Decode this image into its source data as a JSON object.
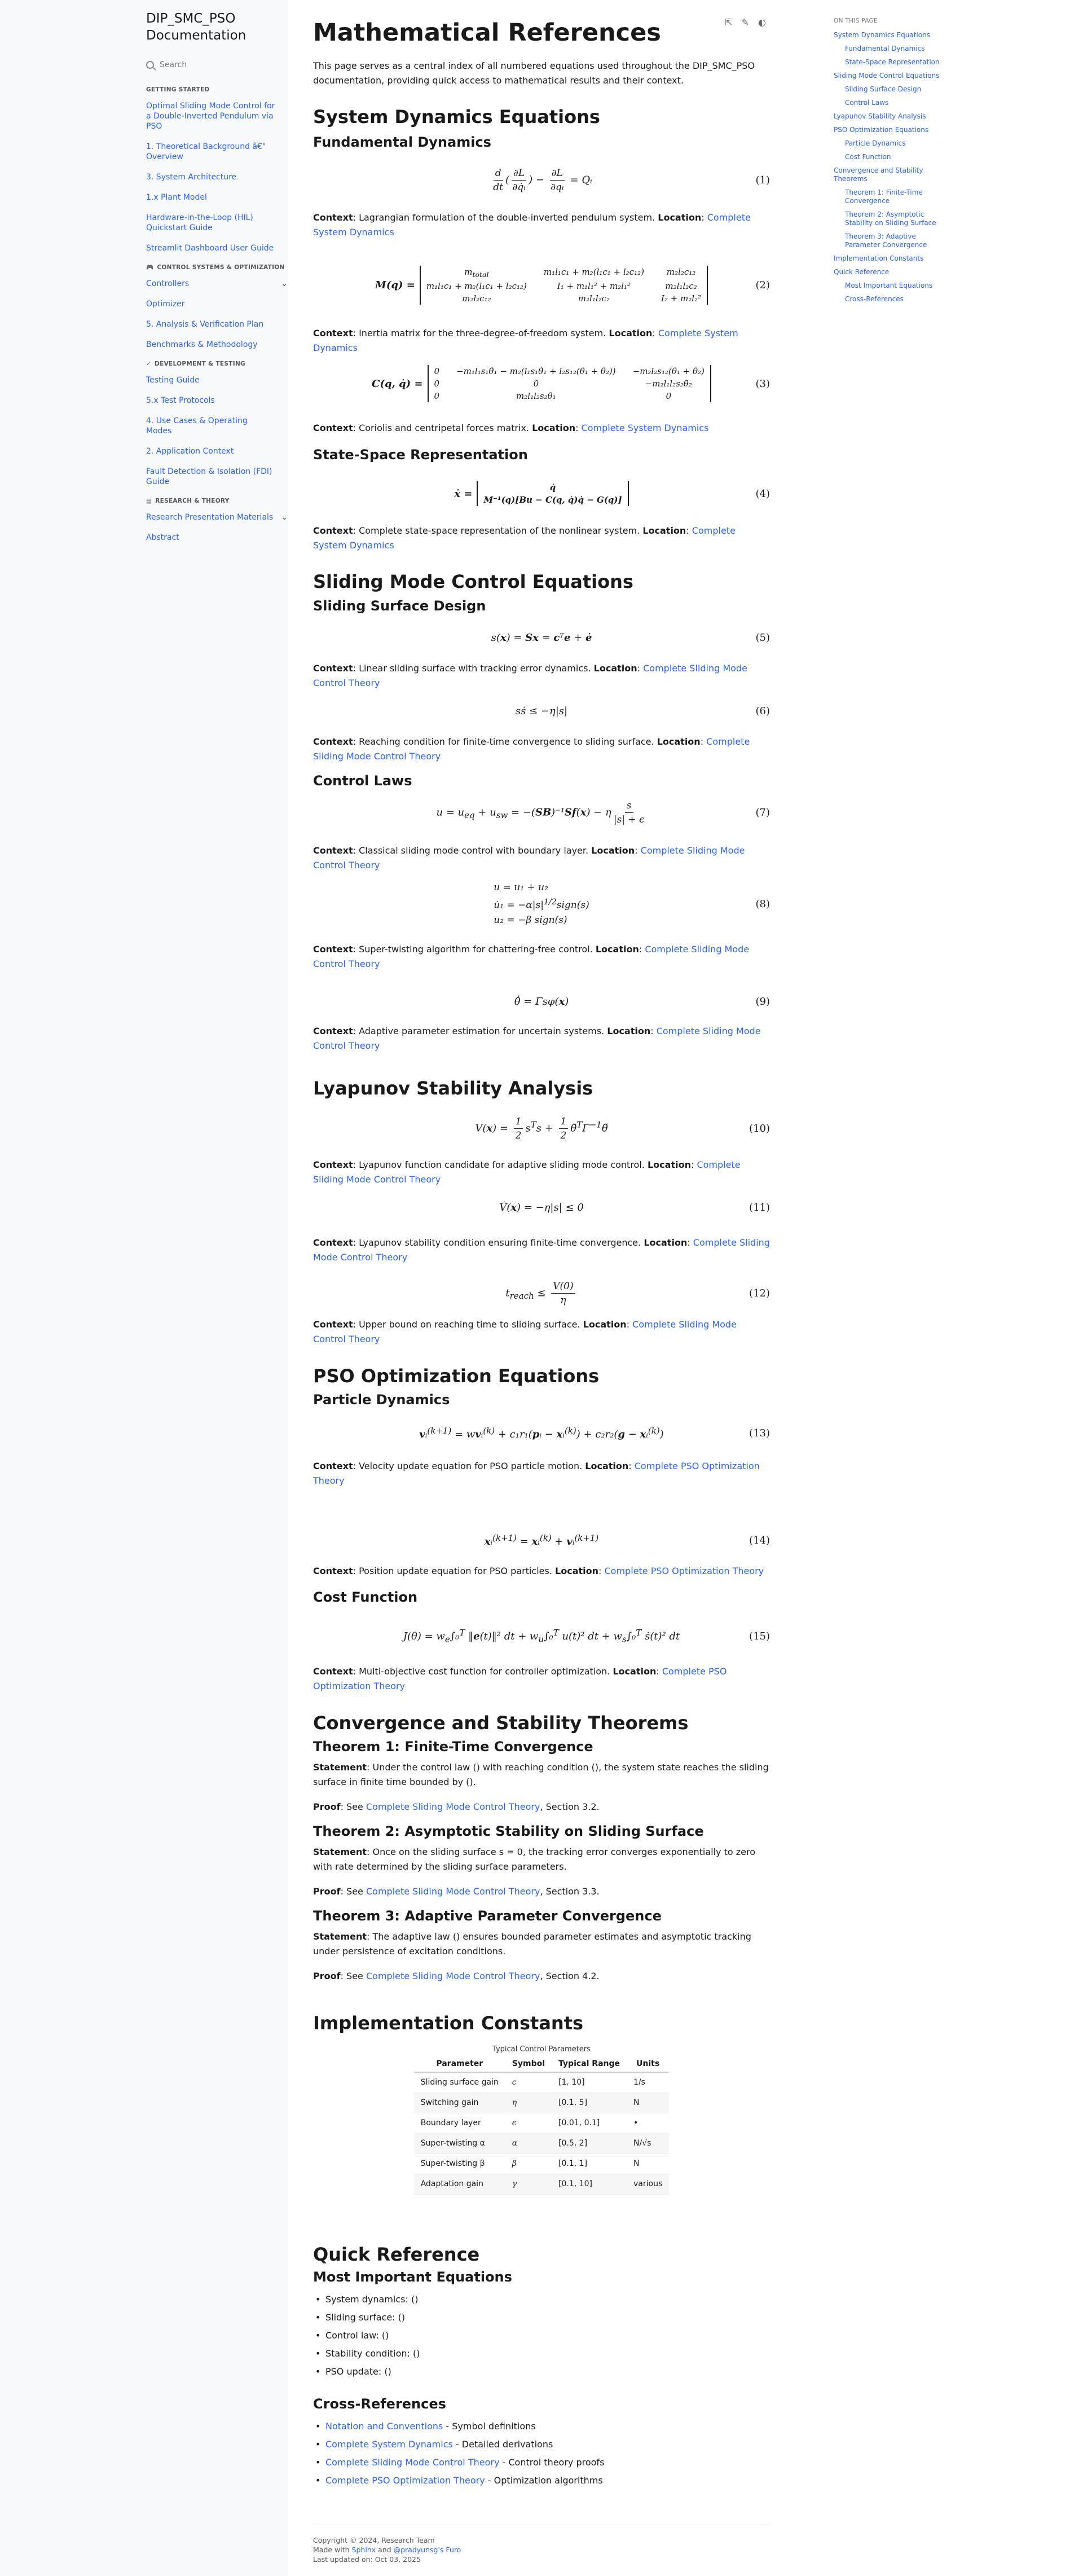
{
  "sidebar": {
    "brand": "DIP_SMC_PSO Documentation",
    "search_placeholder": "Search",
    "groups": [
      {
        "caption": "GETTING STARTED",
        "emoji": "",
        "items": [
          {
            "label": "Optimal Sliding Mode Control for a Double-Inverted Pendulum via PSO"
          },
          {
            "label": "1. Theoretical Background â€\" Overview"
          },
          {
            "label": "3. System Architecture"
          },
          {
            "label": "1.x Plant Model"
          },
          {
            "label": "Hardware-in-the-Loop (HIL) Quickstart Guide"
          },
          {
            "label": "Streamlit Dashboard User Guide"
          }
        ]
      },
      {
        "caption": "CONTROL SYSTEMS & OPTIMIZATION",
        "emoji": "🎮",
        "items": [
          {
            "label": "Controllers",
            "expand": true
          },
          {
            "label": "Optimizer"
          },
          {
            "label": "5. Analysis & Verification Plan"
          },
          {
            "label": "Benchmarks & Methodology"
          }
        ]
      },
      {
        "caption": "DEVELOPMENT & TESTING",
        "emoji": "✓",
        "items": [
          {
            "label": "Testing Guide"
          },
          {
            "label": "5.x Test Protocols"
          },
          {
            "label": "4. Use Cases & Operating Modes"
          },
          {
            "label": "2. Application Context"
          },
          {
            "label": "Fault Detection & Isolation (FDI) Guide"
          }
        ]
      },
      {
        "caption": "RESEARCH & THEORY",
        "emoji": "▤",
        "items": [
          {
            "label": "Research Presentation Materials",
            "expand": true
          },
          {
            "label": "Abstract"
          }
        ]
      }
    ]
  },
  "toolbar": {
    "icons": [
      "view-source-icon",
      "edit-icon",
      "theme-toggle-icon"
    ]
  },
  "page": {
    "title": "Mathematical References",
    "intro": "This page serves as a central index of all numbered equations used throughout the DIP_SMC_PSO documentation, providing quick access to mathematical results and their context.",
    "ctx_label": "Context",
    "loc_label": "Location",
    "links": {
      "system_dynamics": "Complete System Dynamics",
      "smc_theory": "Complete Sliding Mode Control Theory",
      "pso_theory": "Complete PSO Optimization Theory",
      "notation": "Notation and Conventions"
    },
    "sec_dynamics": "System Dynamics Equations",
    "sub_fundamental": "Fundamental Dynamics",
    "ctx_1": "Lagrangian formulation of the double-inverted pendulum system.",
    "ctx_2": "Inertia matrix for the three-degree-of-freedom system.",
    "ctx_3": "Coriolis and centripetal forces matrix.",
    "sub_statespace": "State-Space Representation",
    "ctx_4": "Complete state-space representation of the nonlinear system.",
    "sec_smc": "Sliding Mode Control Equations",
    "sub_surface": "Sliding Surface Design",
    "ctx_5": "Linear sliding surface with tracking error dynamics.",
    "ctx_6": "Reaching condition for finite-time convergence to sliding surface.",
    "sub_laws": "Control Laws",
    "ctx_7": "Classical sliding mode control with boundary layer.",
    "ctx_8": "Super-twisting algorithm for chattering-free control.",
    "ctx_9": "Adaptive parameter estimation for uncertain systems.",
    "sec_lyap": "Lyapunov Stability Analysis",
    "ctx_10": "Lyapunov function candidate for adaptive sliding mode control.",
    "ctx_11": "Lyapunov stability condition ensuring finite-time convergence.",
    "ctx_12": "Upper bound on reaching time to sliding surface.",
    "sec_pso": "PSO Optimization Equations",
    "sub_particle": "Particle Dynamics",
    "ctx_13": "Velocity update equation for PSO particle motion.",
    "ctx_14": "Position update equation for PSO particles.",
    "sub_cost": "Cost Function",
    "ctx_15": "Multi-objective cost function for controller optimization.",
    "sec_conv": "Convergence and Stability Theorems",
    "thm1_title": "Theorem 1: Finite-Time Convergence",
    "thm1_statement": "Under the control law () with reaching condition (), the system state reaches the sliding surface in finite time bounded by ().",
    "thm1_section": ", Section 3.2.",
    "thm2_title": "Theorem 2: Asymptotic Stability on Sliding Surface",
    "thm2_statement": "Once on the sliding surface s = 0, the tracking error converges exponentially to zero with rate determined by the sliding surface parameters.",
    "thm2_section": ", Section 3.3.",
    "thm3_title": "Theorem 3: Adaptive Parameter Convergence",
    "thm3_statement": "The adaptive law () ensures bounded parameter estimates and asymptotic tracking under persistence of excitation conditions.",
    "thm3_section": ", Section 4.2.",
    "statement_label": "Statement",
    "proof_label": "Proof",
    "proof_see": "See",
    "sec_impl": "Implementation Constants",
    "table_caption": "Typical Control Parameters",
    "table_headers": [
      "Parameter",
      "Symbol",
      "Typical Range",
      "Units"
    ],
    "table_rows": [
      [
        "Sliding surface gain",
        "c",
        "[1, 10]",
        "1/s"
      ],
      [
        "Switching gain",
        "η",
        "[0.1, 5]",
        "N"
      ],
      [
        "Boundary layer",
        "ϵ",
        "[0.01, 0.1]",
        "•"
      ],
      [
        "Super-twisting α",
        "α",
        "[0.5, 2]",
        "N/√s"
      ],
      [
        "Super-twisting β",
        "β",
        "[0.1, 1]",
        "N"
      ],
      [
        "Adaptation gain",
        "γ",
        "[0.1, 10]",
        "various"
      ]
    ],
    "sec_quick": "Quick Reference",
    "sub_most": "Most Important Equations",
    "quick_list": [
      "System dynamics: ()",
      "Sliding surface: ()",
      "Control law: ()",
      "Stability condition: ()",
      "PSO update: ()"
    ],
    "sub_xref": "Cross-References",
    "xref_descs": [
      " - Symbol definitions",
      " - Detailed derivations",
      " - Control theory proofs",
      " - Optimization algorithms"
    ]
  },
  "equation_numbers": [
    "(1)",
    "(2)",
    "(3)",
    "(4)",
    "(5)",
    "(6)",
    "(7)",
    "(8)",
    "(9)",
    "(10)",
    "(11)",
    "(12)",
    "(13)",
    "(14)",
    "(15)"
  ],
  "footer": {
    "copyright": "Copyright © 2024, Research Team",
    "made_with_prefix": "Made with ",
    "sphinx": "Sphinx",
    "and": " and ",
    "furo": "@pradyunsg's Furo",
    "last_updated": "Last updated on: Oct 03, 2025"
  },
  "toc": {
    "caption": "ON THIS PAGE",
    "items": [
      {
        "label": "System Dynamics Equations",
        "level": 1
      },
      {
        "label": "Fundamental Dynamics",
        "level": 2
      },
      {
        "label": "State-Space Representation",
        "level": 2
      },
      {
        "label": "Sliding Mode Control Equations",
        "level": 1
      },
      {
        "label": "Sliding Surface Design",
        "level": 2
      },
      {
        "label": "Control Laws",
        "level": 2
      },
      {
        "label": "Lyapunov Stability Analysis",
        "level": 1
      },
      {
        "label": "PSO Optimization Equations",
        "level": 1
      },
      {
        "label": "Particle Dynamics",
        "level": 2
      },
      {
        "label": "Cost Function",
        "level": 2
      },
      {
        "label": "Convergence and Stability Theorems",
        "level": 1
      },
      {
        "label": "Theorem 1: Finite-Time Convergence",
        "level": 2
      },
      {
        "label": "Theorem 2: Asymptotic Stability on Sliding Surface",
        "level": 2
      },
      {
        "label": "Theorem 3: Adaptive Parameter Convergence",
        "level": 2
      },
      {
        "label": "Implementation Constants",
        "level": 1
      },
      {
        "label": "Quick Reference",
        "level": 1
      },
      {
        "label": "Most Important Equations",
        "level": 2
      },
      {
        "label": "Cross-References",
        "level": 2
      }
    ]
  }
}
